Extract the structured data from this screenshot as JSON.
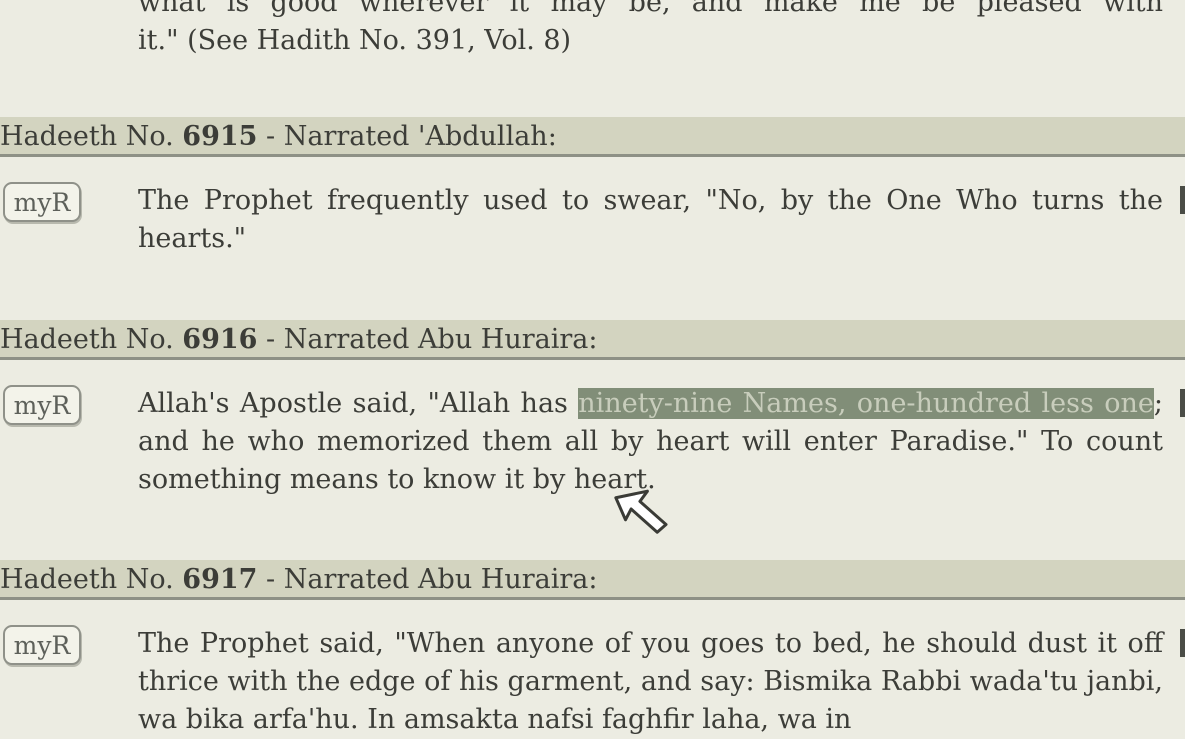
{
  "previous_hadith": {
    "text_line1": "what is good wherever it may be, and make me be pleased with",
    "text_line2": "it.\" (See Hadith No. 391, Vol. 8)"
  },
  "hadiths": [
    {
      "header_prefix": "Hadeeth No. ",
      "number": "6915",
      "header_suffix": " - Narrated 'Abdullah:",
      "button_label": "myR",
      "text": "The Prophet frequently used to swear, \"No, by the One Who turns the hearts.\""
    },
    {
      "header_prefix": "Hadeeth No. ",
      "number": "6916",
      "header_suffix": " - Narrated Abu Huraira:",
      "button_label": "myR",
      "text_before": "Allah's Apostle said, \"Allah has ",
      "text_highlighted": "ninety-nine Names, one-hundred less one",
      "text_after": "; and he who memorized them all by heart will enter Paradise.\" To count something means to know it by heart."
    },
    {
      "header_prefix": "Hadeeth No. ",
      "number": "6917",
      "header_suffix": " - Narrated Abu Huraira:",
      "button_label": "myR",
      "text": "The Prophet said, \"When anyone of you goes to bed, he should dust it off thrice with the edge of his garment, and say: Bismika Rabbi wada'tu janbi, wa bika arfa'hu. In amsakta nafsi faghfir laha, wa in"
    }
  ]
}
